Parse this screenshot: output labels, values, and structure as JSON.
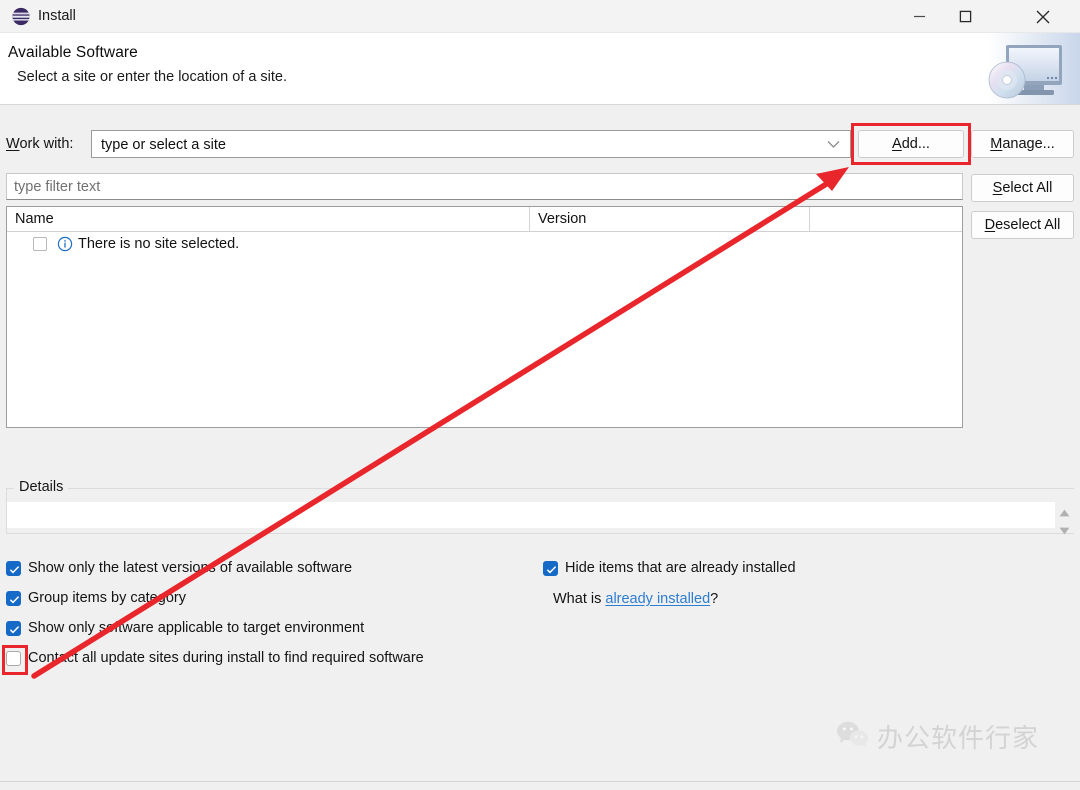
{
  "window": {
    "title": "Install",
    "app_icon": "eclipse-icon",
    "controls": {
      "minimize": "minimize-icon",
      "maximize": "maximize-icon",
      "close": "close-icon"
    }
  },
  "header": {
    "title": "Available Software",
    "subtitle": "Select a site or enter the location of a site.",
    "banner_icon": "install-monitor-disc-icon"
  },
  "work_with": {
    "label_prefix": "W",
    "label_rest": "ork with:",
    "combo_value": "type or select a site",
    "combo_arrow": "chevron-down-icon"
  },
  "filter": {
    "placeholder": "type filter text",
    "value": ""
  },
  "table": {
    "columns": [
      "Name",
      "Version"
    ],
    "rows": [
      {
        "checked": false,
        "icon": "info-icon",
        "name": "There is no site selected.",
        "version": ""
      }
    ]
  },
  "buttons": {
    "add": {
      "mnemonic": "A",
      "rest": "dd...",
      "highlighted": true
    },
    "manage": {
      "prefix": "M",
      "rest": "anage..."
    },
    "select_all": {
      "pre": "",
      "mnemonic": "S",
      "rest": "elect All"
    },
    "deselect_all": {
      "mnemonic": "D",
      "rest": "eselect All"
    }
  },
  "details": {
    "legend": "Details",
    "content": "",
    "scroll_up_icon": "scroll-up-icon",
    "scroll_down_icon": "scroll-down-icon"
  },
  "options": {
    "show_latest": {
      "label": "Show only the latest versions of available software",
      "checked": true
    },
    "group_by_category": {
      "label": "Group items by category",
      "checked": true
    },
    "show_applicable": {
      "label": "Show only software applicable to target environment",
      "checked": true
    },
    "contact_update_sites": {
      "label": "Contact all update sites during install to find required software",
      "checked": false,
      "highlighted": true
    },
    "hide_installed": {
      "label": "Hide items that are already installed",
      "checked": true
    }
  },
  "what_is": {
    "prefix": "What is ",
    "link": "already installed",
    "suffix": "?"
  },
  "annotations": {
    "color": "#e8262b",
    "arrow_from": "contact-all-update-sites-checkbox",
    "arrow_to": "add-button"
  },
  "watermark": {
    "icon": "wechat-icon",
    "text": "办公软件行家"
  },
  "colors": {
    "accent": "#1569c7",
    "link": "#2d7dd2",
    "annotation": "#e8262b",
    "window_bg": "#f0f0f0",
    "field_bg": "#ffffff"
  }
}
